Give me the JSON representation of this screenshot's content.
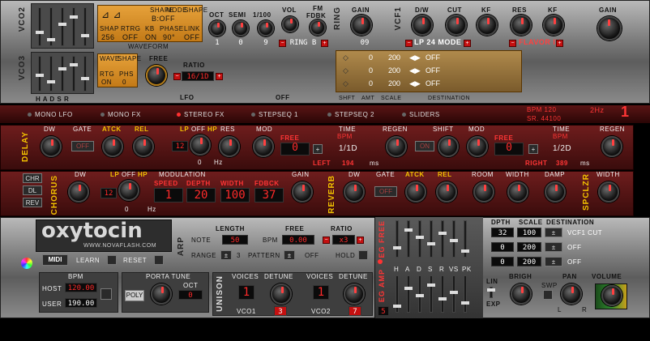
{
  "synth": {
    "vco2_label": "VCO2",
    "vco3_label": "VCO3",
    "hadsr": "H A D S R",
    "waveform_label": "WAVEFORM",
    "vco2_wave_headers": [
      "SHAPE",
      "MODE",
      "SHAPE"
    ],
    "vco2_wave_values": [
      "B:OFF"
    ],
    "vco2_params_headers": [
      "SHAP",
      "RTRG",
      "KB",
      "PHASE",
      "LINK"
    ],
    "vco2_params_values": [
      "256",
      "OFF",
      "ON",
      "90°",
      "OFF"
    ],
    "osc_headers": [
      "OCT",
      "SEMI",
      "1/100",
      "VOL",
      "FM",
      "FDBK"
    ],
    "osc_values": [
      "1",
      "0",
      "9"
    ],
    "ring_mode": "RING B",
    "ring_label": "RING",
    "gain_label": "GAIN",
    "gain_value": "09",
    "vcf1_label": "VCF1",
    "filter_headers": [
      "D/W",
      "CUT",
      "KF",
      "RES",
      "KF"
    ],
    "filter_mode": "LP 24 MODE",
    "filter_flavor": "FLAVOR IV",
    "master_gain_label": "GAIN",
    "lfo_wave_headers": [
      "WAVE",
      "SHAPE"
    ],
    "lfo_params": [
      "RTG",
      "PHS"
    ],
    "lfo_values": [
      "ON",
      "0"
    ],
    "lfo_free": "FREE",
    "lfo_ratio_label": "RATIO",
    "lfo_ratio": "16/1D",
    "lfo_label": "LFO",
    "off_label": "OFF",
    "lfo_dest_rows": [
      {
        "amt": "0",
        "scale": "200",
        "dest": "OFF"
      },
      {
        "amt": "0",
        "scale": "200",
        "dest": "OFF"
      },
      {
        "amt": "0",
        "scale": "200",
        "dest": "OFF"
      }
    ],
    "lfo_dest_header": [
      "SHFT",
      "AMT",
      "SCALE",
      "DESTINATION"
    ]
  },
  "tabs": {
    "items": [
      "MONO LFO",
      "MONO FX",
      "STEREO FX",
      "STEPSEQ 1",
      "STEPSEQ 2",
      "SLIDERS"
    ],
    "bpm": "BPM 120",
    "sr": "SR. 44100",
    "hz": "2Hz",
    "page": "1"
  },
  "delay": {
    "title": "DELAY",
    "headers": [
      "DW",
      "GATE",
      "ATCK",
      "REL",
      "LP",
      "OFF",
      "HP",
      "RES",
      "MOD",
      "FREE",
      "TIME",
      "REGEN",
      "SHIFT",
      "MOD",
      "FREE",
      "TIME",
      "REGEN"
    ],
    "gate": "OFF",
    "filter_val": "12",
    "filter_hz": "Hz",
    "filter_zero": "0",
    "bpm_label": "BPM",
    "left_bpm": "0",
    "left_time": "1/1D",
    "left_label": "LEFT",
    "left_ms": "194",
    "ms": "ms",
    "right_bpm": "0",
    "right_time": "1/2D",
    "right_label": "RIGHT",
    "right_ms": "389",
    "shift": "ON"
  },
  "chorus": {
    "title": "CHORUS",
    "side": [
      "CHR",
      "DL",
      "REV"
    ],
    "headers": [
      "DW",
      "LP",
      "OFF",
      "HP",
      "MODULATION",
      "GAIN"
    ],
    "filter_val": "12",
    "filter_zero": "0",
    "filter_hz": "Hz",
    "mod_headers": [
      "SPEED",
      "DEPTH",
      "WIDTH",
      "FDBCK"
    ],
    "mod_values": [
      "1",
      "20",
      "100",
      "37"
    ]
  },
  "reverb": {
    "title": "REVERB",
    "headers": [
      "DW",
      "GATE",
      "ATCK",
      "REL",
      "ROOM",
      "WIDTH",
      "DAMP"
    ],
    "gate": "OFF"
  },
  "spclzr": {
    "title": "SPCLZR",
    "width_label": "WIDTH"
  },
  "brand": {
    "name": "oxytocin",
    "url": "WWW.NOVAFLASH.COM"
  },
  "midi": {
    "midi": "MIDI",
    "learn": "LEARN",
    "reset": "RESET"
  },
  "arp": {
    "label": "ARP",
    "length_label": "LENGTH",
    "free_label": "FREE",
    "ratio_label": "RATIO",
    "note_label": "NOTE",
    "note_value": "50",
    "bpm_label": "BPM",
    "bpm_value": "0.00",
    "ratio_value": "x3",
    "range_label": "RANGE",
    "range_value": "3",
    "pattern_label": "PATTERN",
    "pattern_value": "OFF",
    "hold_label": "HOLD"
  },
  "bpm_box": {
    "label": "BPM",
    "host_label": "HOST",
    "host_value": "120.00",
    "user_label": "USER",
    "user_value": "190.00"
  },
  "porta": {
    "label": "PORTA TUNE",
    "poly": "POLY",
    "oct_label": "OCT",
    "oct_value": "0"
  },
  "unison": {
    "label": "UNISON",
    "voices": "VOICES",
    "detune": "DETUNE",
    "vco1_label": "VCO1",
    "vco1_voices": "1",
    "vco1_detune": "3",
    "vco2_label": "VCO2",
    "vco2_voices": "1",
    "vco2_detune": "7"
  },
  "eg": {
    "free_label": "EG FREE",
    "amp_label": "EG AMP",
    "stages": [
      "H",
      "A",
      "D",
      "S",
      "R",
      "VS",
      "PK"
    ],
    "amp_value": "5",
    "dest_headers": [
      "DPTH",
      "SCALE",
      "DESTINATION"
    ],
    "rows": [
      {
        "depth": "32",
        "scale": "100",
        "dest": "VCF1 CUT"
      },
      {
        "depth": "0",
        "scale": "200",
        "dest": "OFF"
      },
      {
        "depth": "0",
        "scale": "200",
        "dest": "OFF"
      }
    ],
    "lin": "LIN",
    "exp": "EXP"
  },
  "out": {
    "brigh": "BRIGH",
    "swp": "SWP",
    "pan": "PAN",
    "volume": "VOLUME",
    "l": "L",
    "r": "R"
  }
}
